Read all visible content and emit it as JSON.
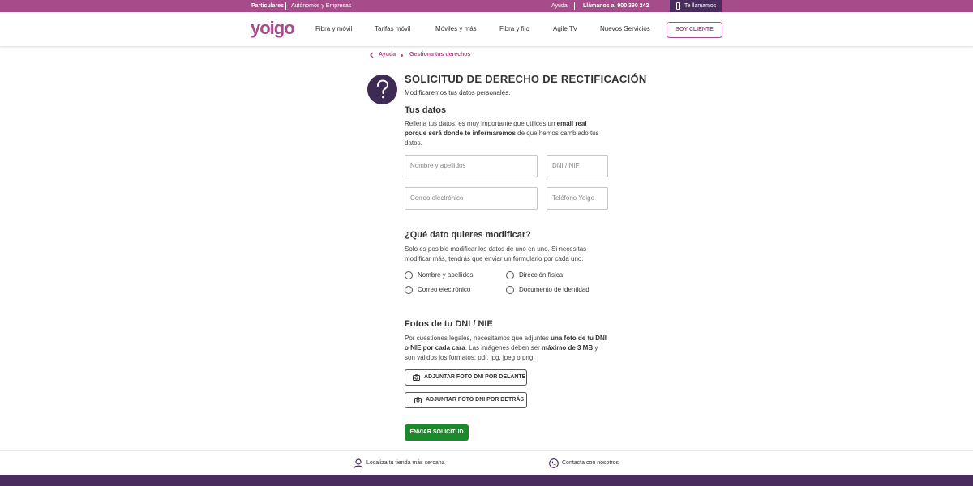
{
  "topbar": {
    "particulares": "Particulares",
    "autonomos": "Autónomos y Empresas",
    "ayuda": "Ayuda",
    "llamanos": "Llámanos al 900 390 242",
    "te_llamamos": "Te llamamos"
  },
  "header": {
    "logo_alt": "yoigo",
    "nav": [
      "Fibra y móvil",
      "Tarifas móvil",
      "Móviles y más",
      "Fibra y fijo",
      "Agile TV",
      "Nuevos Servicios"
    ],
    "soy_cliente": "SOY CLIENTE"
  },
  "breadcrumb": {
    "items": [
      "Ayuda",
      "Gestiona tus derechos"
    ]
  },
  "main": {
    "title": "SOLICITUD DE DERECHO DE RECTIFICACIÓN",
    "subtitle": "Modificaremos tus datos personales.",
    "tus_datos": {
      "heading": "Tus datos",
      "text_1": "Rellena tus datos, es muy importante que utilices un ",
      "text_bold": "email real porque será donde te informaremos",
      "text_2": " de que hemos cambiado tus datos."
    },
    "fields": {
      "nombre_placeholder": "Nombre y apellidos",
      "dni_placeholder": "DNI / NIF",
      "correo_placeholder": "Correo electrónico",
      "telefono_placeholder": "Teléfono Yoigo"
    },
    "modificar": {
      "heading": "¿Qué dato quieres modificar?",
      "text": "Solo es posible modificar los datos de uno en uno. Si necesitas modificar más, tendrás que enviar un formulario por cada uno.",
      "options": [
        "Nombre y apellidos",
        "Dirección física",
        "Correo electrónico",
        "Documento de identidad"
      ]
    },
    "fotos": {
      "heading": "Fotos de tu DNI / NIE",
      "text_1": "Por cuestiones legales, necesitamos que adjuntes ",
      "text_bold_1": "una foto de tu DNI o NIE por cada cara",
      "text_2": ". Las imágenes deben ser ",
      "text_bold_2": "máximo de 3 MB",
      "text_3": " y son válidos los formatos: pdf, jpg, jpeg o png.",
      "attach_front": "ADJUNTAR FOTO DNI POR DELANTE",
      "attach_back": "ADJUNTAR FOTO DNI POR DETRÁS"
    },
    "submit": "ENVIAR SOLICITUD"
  },
  "footer": {
    "tienda": "Localiza tu tienda más cercana",
    "contacta": "Contacta con nosotros"
  },
  "colors": {
    "brand": "#a64c8a",
    "dark": "#4a2d5e",
    "submit": "#1b8a2a"
  }
}
